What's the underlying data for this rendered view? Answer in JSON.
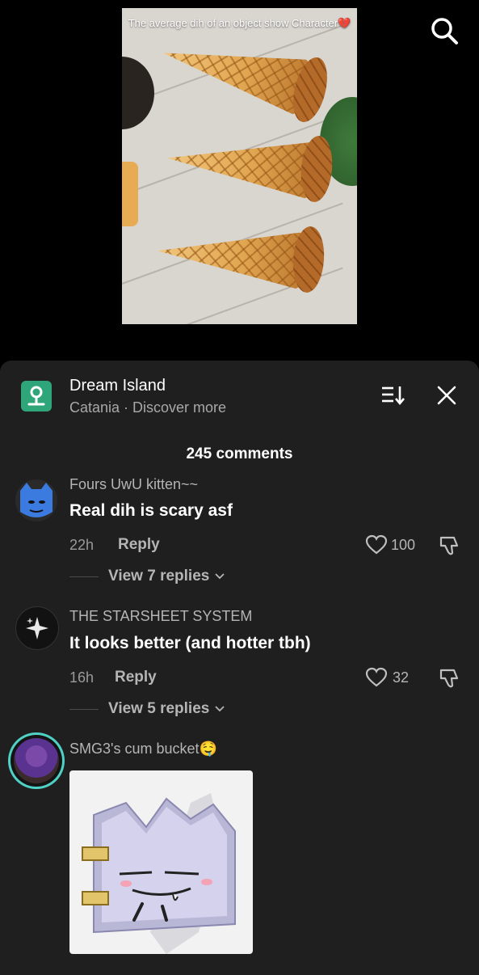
{
  "video": {
    "overlay_text": "The average dih of an object show Character💔"
  },
  "header": {
    "location_title": "Dream Island",
    "location_subtitle": "Catania · Discover more"
  },
  "comments_count": "245 comments",
  "comments": [
    {
      "username": "Fours UwU kitten~~",
      "text": "Real dih is scary asf",
      "time": "22h",
      "reply_label": "Reply",
      "likes": "100",
      "view_replies": "View 7 replies"
    },
    {
      "username": "THE STARSHEET SYSTEM",
      "text": "It looks better (and hotter tbh)",
      "time": "16h",
      "reply_label": "Reply",
      "likes": "32",
      "view_replies": "View 5 replies"
    },
    {
      "username": "SMG3's cum bucket🤤"
    }
  ],
  "colors": {
    "background": "#000000",
    "sheet": "#1f1f1f",
    "location_icon": "#2fa67a",
    "avatar_ring": "#4fd1c5"
  },
  "icons": [
    "search-icon",
    "location-pin-icon",
    "sort-icon",
    "close-icon",
    "heart-icon",
    "dislike-icon",
    "chevron-down-icon"
  ]
}
